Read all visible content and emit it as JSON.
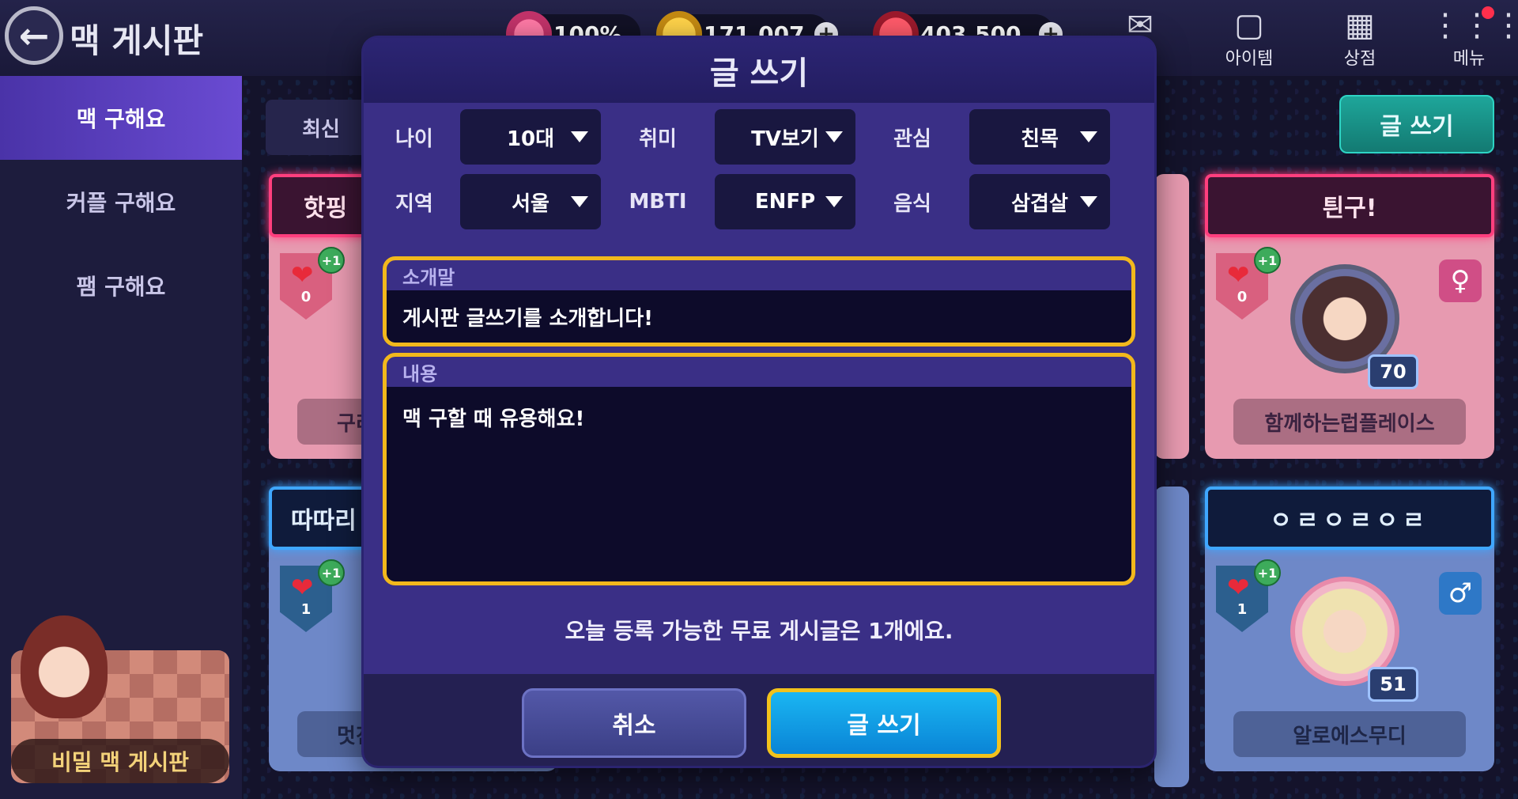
{
  "topbar": {
    "title": "맥 게시판",
    "back_icon": "back-arrow-icon",
    "heart_value": "100%",
    "gold_value": "171,007",
    "ruby_value": "403,500",
    "icons": [
      {
        "name": "mail-icon",
        "label": ""
      },
      {
        "name": "item-icon",
        "label": "아이템"
      },
      {
        "name": "shop-icon",
        "label": "상점"
      },
      {
        "name": "menu-icon",
        "label": "메뉴"
      }
    ]
  },
  "sidebar": {
    "items": [
      {
        "label": "맥 구해요",
        "active": true
      },
      {
        "label": "커플 구해요",
        "active": false
      },
      {
        "label": "팸 구해요",
        "active": false
      }
    ],
    "secret_board_label": "비밀 맥 게시판"
  },
  "board": {
    "tab_recent": "최신",
    "write_button": "글 쓰기",
    "cards": [
      {
        "banner": "핫핑",
        "likes": "0",
        "nick": "구리",
        "color": "pink"
      },
      {
        "banner": "따따리",
        "likes": "1",
        "nick": "멋진",
        "color": "blue"
      },
      {
        "banner": "틘구!",
        "likes": "0",
        "level": "70",
        "gender": "female",
        "nick": "함께하는럽플레이스",
        "color": "pink"
      },
      {
        "banner": "ㅇㄹㅇㄹㅇㄹ",
        "likes": "1",
        "level": "51",
        "gender": "male",
        "nick": "알로에스무디",
        "color": "blue"
      }
    ],
    "plus_one": "+1"
  },
  "modal": {
    "title": "글 쓰기",
    "filters": [
      [
        {
          "label": "나이",
          "value": "10대"
        },
        {
          "label": "취미",
          "value": "TV보기"
        },
        {
          "label": "관심",
          "value": "친목"
        }
      ],
      [
        {
          "label": "지역",
          "value": "서울"
        },
        {
          "label": "MBTI",
          "value": "ENFP"
        },
        {
          "label": "음식",
          "value": "삼겹살"
        }
      ]
    ],
    "intro": {
      "label": "소개말",
      "value": "게시판 글쓰기를 소개합니다!"
    },
    "content": {
      "label": "내용",
      "value": "맥 구할 때 유용해요!"
    },
    "notice": "오늘 등록 가능한 무료 게시글은 1개에요.",
    "cancel_label": "취소",
    "submit_label": "글 쓰기"
  },
  "colors": {
    "accent_yellow": "#f2b81c",
    "modal_bg": "#3a2f86",
    "submit_blue": "#0a84d6"
  }
}
